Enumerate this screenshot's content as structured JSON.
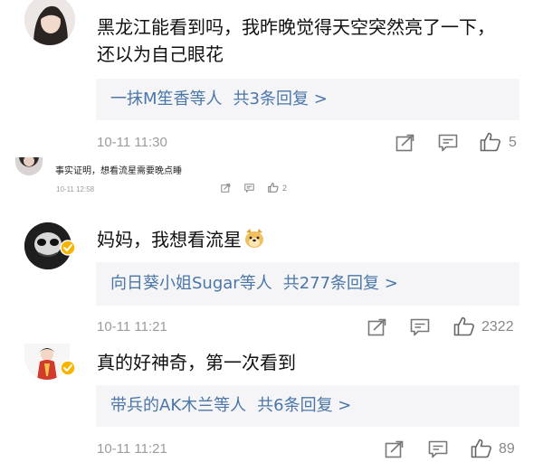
{
  "comments": [
    {
      "text_line1": "黑龙江能看到吗，我昨晚觉得天空突然亮了一下，",
      "text_line2": "还以为自己眼花",
      "reply": {
        "name": "一抹M笙香",
        "mid": "等人",
        "count": "共3条回复 >"
      },
      "time": "10-11 11:30",
      "likes": "5"
    },
    {
      "text": "事实证明，想看流星需要晚点睡",
      "time": "10-11 12:58",
      "likes": "2"
    },
    {
      "text": "妈妈，我想看流星",
      "emoji": "doge-emoji",
      "reply": {
        "name": "向日葵小姐Sugar",
        "mid": "等人",
        "count": "共277条回复 >"
      },
      "time": "10-11 11:21",
      "likes": "2322"
    },
    {
      "text": "真的好神奇，第一次看到",
      "reply": {
        "name": "带兵的AK木兰",
        "mid": "等人",
        "count": "共6条回复 >"
      },
      "time": "10-11 11:21",
      "likes": "89"
    }
  ],
  "icons": {
    "forward": "forward-icon",
    "comment": "comment-icon",
    "like": "thumbs-up-icon",
    "verified": "verified-badge-icon"
  },
  "colors": {
    "link": "#4a76a8",
    "reply_bg": "#f5f5f7",
    "meta": "#9b9b9b",
    "verified": "#f7b500"
  }
}
